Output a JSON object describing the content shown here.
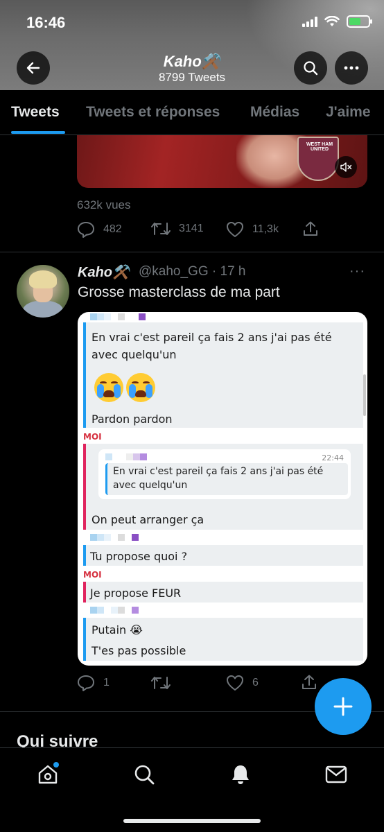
{
  "status_bar": {
    "time": "16:46"
  },
  "header": {
    "profile_name": "Kaho⚒️",
    "tweet_count": "8799 Tweets",
    "icons": [
      "back-arrow-icon",
      "search-icon",
      "more-icon"
    ]
  },
  "tabs": [
    {
      "label": "Tweets",
      "active": true
    },
    {
      "label": "Tweets et réponses",
      "active": false
    },
    {
      "label": "Médias",
      "active": false
    },
    {
      "label": "J'aime",
      "active": false
    }
  ],
  "previous_tweet": {
    "media_badge": "WEST HAM UNITED",
    "views": "632k vues",
    "replies": "482",
    "retweets": "3141",
    "likes": "11,3k"
  },
  "tweet": {
    "display_name": "Kaho⚒️",
    "handle_time": "@kaho_GG · 17 h",
    "more": "···",
    "text": "Grosse masterclass de ma part",
    "replies": "1",
    "retweets": "",
    "likes": "6"
  },
  "screenshot": {
    "msg1_line1": "En vrai c'est pareil ça fais 2 ans j'ai pas été",
    "msg1_line2": "avec quelqu'un",
    "msg2": "Pardon pardon",
    "moi_label": "MOI",
    "quote_time": "22:44",
    "quote_line1": "En vrai c'est pareil ça fais 2 ans j'ai pas été",
    "quote_line2": "avec quelqu'un",
    "msg3": "On peut arranger ça",
    "msg4": "Tu propose quoi ?",
    "msg5": "Je propose FEUR",
    "msg6": "Putain 😭",
    "msg7": "T'es pas possible"
  },
  "who_to_follow": "Qui suivre",
  "bottom_nav": [
    "home-icon",
    "search-icon",
    "notifications-icon",
    "messages-icon"
  ],
  "colors": {
    "accent": "#1d9bf0",
    "background": "#000000",
    "muted": "#71767b",
    "moi_red": "#d6303f"
  }
}
